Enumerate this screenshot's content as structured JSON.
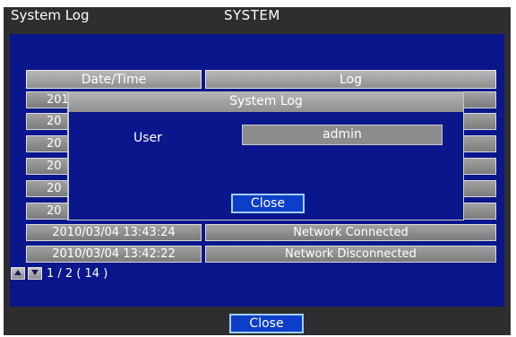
{
  "window": {
    "title": "System Log",
    "section": "SYSTEM"
  },
  "table": {
    "headers": [
      "Date/Time",
      "Log"
    ],
    "rows": [
      {
        "datetime": "2010",
        "log": ""
      },
      {
        "datetime": "20",
        "log": ""
      },
      {
        "datetime": "20",
        "log": ""
      },
      {
        "datetime": "20",
        "log": ""
      },
      {
        "datetime": "20",
        "log": ""
      },
      {
        "datetime": "20",
        "log": ""
      },
      {
        "datetime": "2010/03/04  13:43:24",
        "log": "Network Connected"
      },
      {
        "datetime": "2010/03/04  13:42:22",
        "log": "Network Disconnected"
      }
    ]
  },
  "pager": {
    "text": "1 / 2 ( 14 )",
    "up_icon": "triangle-up-icon",
    "down_icon": "triangle-down-icon"
  },
  "modal": {
    "title": "System Log",
    "user_label": "User",
    "user_value": "admin",
    "close_label": "Close"
  },
  "footer": {
    "close_label": "Close"
  },
  "colors": {
    "panel": "#0a168c",
    "frame": "#2e2e30",
    "button": "#0d3ec9",
    "button_border": "#9fd0ff",
    "row": "#8e8e8e"
  }
}
